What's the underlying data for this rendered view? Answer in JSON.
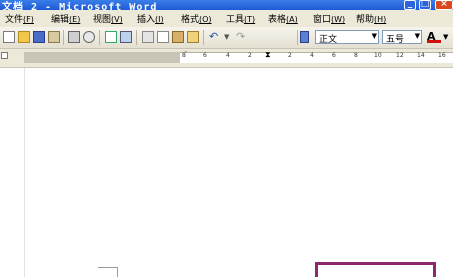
{
  "window": {
    "title": "文档 2 - Microsoft Word",
    "controls": {
      "minimize": "_",
      "maximize": "□",
      "close": "×"
    }
  },
  "menu": [
    {
      "label": "文件",
      "key": "(F)"
    },
    {
      "label": "编辑",
      "key": "(E)"
    },
    {
      "label": "视图",
      "key": "(V)"
    },
    {
      "label": "插入",
      "key": "(I)"
    },
    {
      "label": "格式",
      "key": "(O)"
    },
    {
      "label": "工具",
      "key": "(T)"
    },
    {
      "label": "表格",
      "key": "(A)"
    },
    {
      "label": "窗口",
      "key": "(W)"
    },
    {
      "label": "帮助",
      "key": "(H)"
    }
  ],
  "toolbar": {
    "style_value": "正文",
    "font_size_value": "五号",
    "font_color_letter": "A",
    "icons": [
      "new-document-icon",
      "open-icon",
      "save-icon",
      "permission-icon",
      "print-icon",
      "print-preview-icon",
      "spelling-icon",
      "research-icon",
      "cut-icon",
      "copy-icon",
      "paste-icon",
      "format-painter-icon",
      "undo-icon",
      "redo-icon"
    ]
  },
  "ruler": {
    "left_ticks": [
      "8",
      "6",
      "4",
      "2"
    ],
    "right_ticks": [
      "2",
      "4",
      "6",
      "8",
      "10",
      "12",
      "14",
      "16"
    ]
  },
  "colors": {
    "title_bar": "#1d5ad6",
    "menu_bg": "#ece9d8",
    "highlight_box": "#8b2a6c"
  }
}
